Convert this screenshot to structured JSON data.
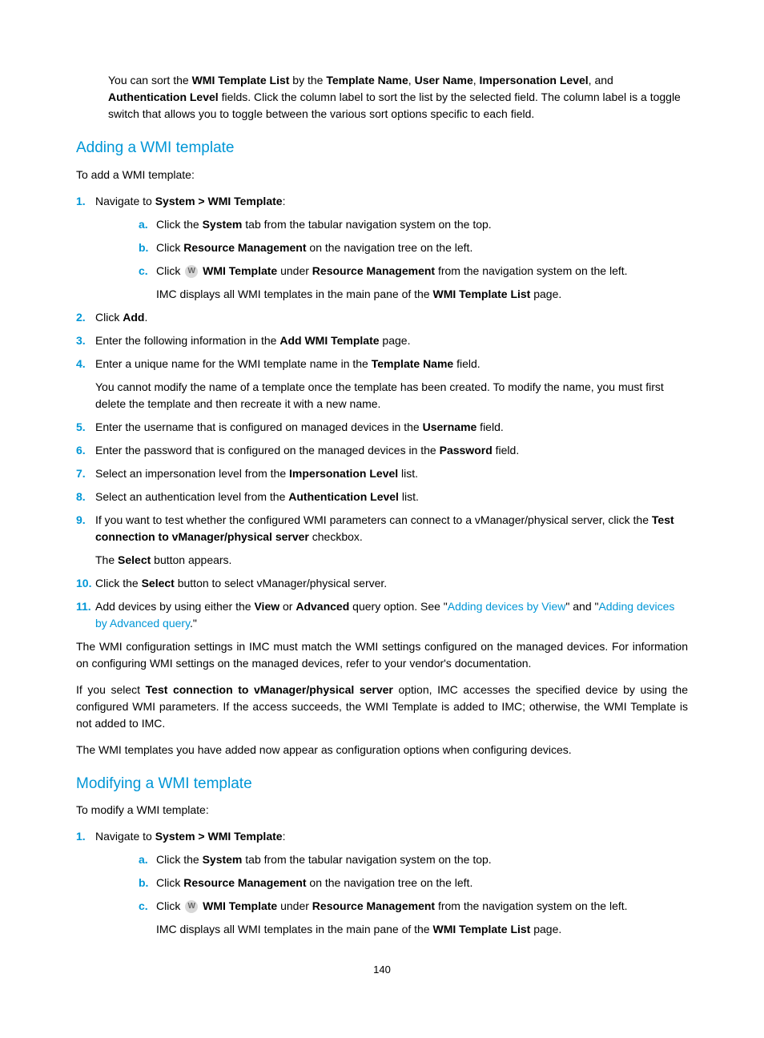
{
  "intro": {
    "t1": "You can sort the ",
    "b1": "WMI Template List",
    "t2": " by the ",
    "b2": "Template Name",
    "t3": ", ",
    "b3": "User Name",
    "t4": ", ",
    "b4": "Impersonation Level",
    "t5": ", and ",
    "b5": "Authentication Level",
    "t6": " fields. Click the column label to sort the list by the selected field. The column label is a toggle switch that allows you to toggle between the various sort options specific to each field."
  },
  "adding": {
    "heading": "Adding a WMI template",
    "lead": "To add a WMI template:",
    "step1": {
      "n": "1.",
      "pre": "Navigate to ",
      "b": "System > WMI Template",
      "post": ":"
    },
    "step1a": {
      "a": "a.",
      "t1": "Click the ",
      "b1": "System",
      "t2": " tab from the tabular navigation system on the top."
    },
    "step1b": {
      "a": "b.",
      "t1": "Click ",
      "b1": "Resource Management",
      "t2": " on the navigation tree on the left."
    },
    "step1c": {
      "a": "c.",
      "t1": "Click ",
      "icon": "W",
      "b1": "WMI Template",
      "t2": " under ",
      "b2": "Resource Management",
      "t3": " from the navigation system on the left."
    },
    "step1c_sub": {
      "t1": "IMC displays all WMI templates in the main pane of the ",
      "b1": "WMI Template List",
      "t2": " page."
    },
    "step2": {
      "n": "2.",
      "t1": "Click ",
      "b1": "Add",
      "t2": "."
    },
    "step3": {
      "n": "3.",
      "t1": "Enter the following information in the ",
      "b1": "Add WMI Template",
      "t2": " page."
    },
    "step4": {
      "n": "4.",
      "t1": "Enter a unique name for the WMI template name in the ",
      "b1": "Template Name",
      "t2": " field."
    },
    "step4_sub": "You cannot modify the name of a template once the template has been created. To modify the name, you must first delete the template and then recreate it with a new name.",
    "step5": {
      "n": "5.",
      "t1": "Enter the username that is configured on managed devices in the ",
      "b1": "Username",
      "t2": " field."
    },
    "step6": {
      "n": "6.",
      "t1": "Enter the password that is configured on the managed devices in the ",
      "b1": "Password",
      "t2": " field."
    },
    "step7": {
      "n": "7.",
      "t1": "Select an impersonation level from the ",
      "b1": "Impersonation Level",
      "t2": " list."
    },
    "step8": {
      "n": "8.",
      "t1": "Select an authentication level from the ",
      "b1": "Authentication Level",
      "t2": " list."
    },
    "step9": {
      "n": "9.",
      "t1": "If you want to test whether the configured WMI parameters can connect to a vManager/physical server, click the ",
      "b1": "Test connection to vManager/physical server",
      "t2": " checkbox."
    },
    "step9_sub": {
      "t1": "The ",
      "b1": "Select",
      "t2": " button appears."
    },
    "step10": {
      "n": "10.",
      "t1": "Click the ",
      "b1": "Select",
      "t2": " button to select vManager/physical server."
    },
    "step11": {
      "n": "11.",
      "t1": "Add devices by using either the ",
      "b1": "View",
      "t2": " or ",
      "b2": "Advanced",
      "t3": " query option. See \"",
      "link1": "Adding devices by View",
      "t4": "\" and \"",
      "link2": "Adding devices by Advanced query",
      "t5": ".\""
    },
    "para1": "The WMI configuration settings in IMC must match the WMI settings configured on the managed devices. For information on configuring WMI settings on the managed devices, refer to your vendor's documentation.",
    "para2": {
      "t1": "If you select ",
      "b1": "Test connection to vManager/physical server",
      "t2": " option, IMC accesses the specified device by using the configured WMI parameters. If the access succeeds, the WMI Template is added to IMC; otherwise, the WMI Template is not added to IMC."
    },
    "para3": "The WMI templates you have added now appear as configuration options when configuring devices."
  },
  "modifying": {
    "heading": "Modifying a WMI template",
    "lead": "To modify a WMI template:",
    "step1": {
      "n": "1.",
      "pre": "Navigate to ",
      "b": "System > WMI Template",
      "post": ":"
    },
    "step1a": {
      "a": "a.",
      "t1": "Click the ",
      "b1": "System",
      "t2": " tab from the tabular navigation system on the top."
    },
    "step1b": {
      "a": "b.",
      "t1": "Click ",
      "b1": "Resource Management",
      "t2": " on the navigation tree on the left."
    },
    "step1c": {
      "a": "c.",
      "t1": "Click ",
      "icon": "W",
      "b1": "WMI Template",
      "t2": " under ",
      "b2": "Resource Management",
      "t3": " from the navigation system on the left."
    },
    "step1c_sub": {
      "t1": "IMC displays all WMI templates in the main pane of the ",
      "b1": "WMI Template List",
      "t2": " page."
    }
  },
  "page_number": "140"
}
